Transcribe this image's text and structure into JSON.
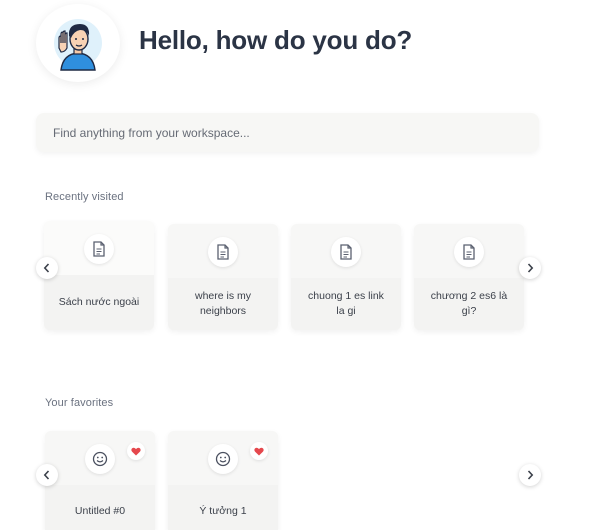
{
  "header": {
    "greeting": "Hello, how do you do?"
  },
  "search": {
    "placeholder": "Find anything from your workspace..."
  },
  "recent": {
    "title": "Recently visited",
    "items": [
      {
        "label": "Sách nước ngoài",
        "icon": "document-icon"
      },
      {
        "label": "where is my neighbors",
        "icon": "document-icon"
      },
      {
        "label": "chuong 1 es link la gi",
        "icon": "document-icon"
      },
      {
        "label": "chương 2 es6 là gì?",
        "icon": "document-icon"
      }
    ]
  },
  "favorites": {
    "title": "Your favorites",
    "items": [
      {
        "label": "Untitled #0",
        "icon": "smiley-icon",
        "favorited": true
      },
      {
        "label": "Ý tưởng 1",
        "icon": "smiley-icon",
        "favorited": true
      }
    ]
  },
  "colors": {
    "heart": "#e5484d",
    "title": "#2b3445",
    "muted": "#6b7280"
  }
}
